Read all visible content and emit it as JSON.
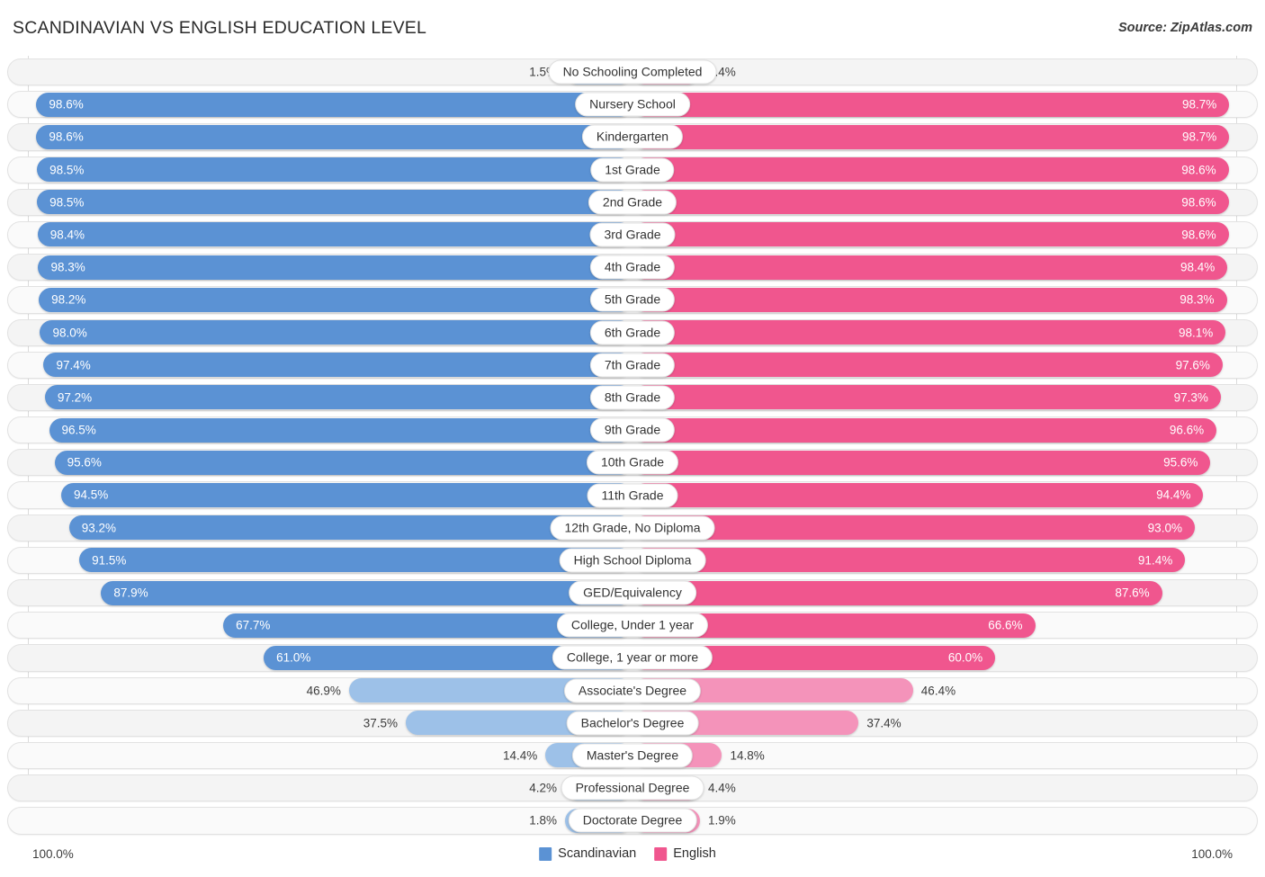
{
  "header": {
    "title": "SCANDINAVIAN VS ENGLISH EDUCATION LEVEL",
    "source": "Source: ZipAtlas.com"
  },
  "footer": {
    "axis_min": "100.0%",
    "axis_max": "100.0%",
    "legend": [
      {
        "label": "Scandinavian",
        "color": "#5b92d4"
      },
      {
        "label": "English",
        "color": "#f0568e"
      }
    ]
  },
  "colors": {
    "scandinavian_strong": "#5b92d4",
    "scandinavian_light": "#9dc1e8",
    "english_strong": "#f0568e",
    "english_light": "#f493ba",
    "track": "#f4f4f4",
    "label_text": "#333333"
  },
  "chart_data": {
    "type": "bar",
    "title": "SCANDINAVIAN VS ENGLISH EDUCATION LEVEL",
    "subtitle": "Source: ZipAtlas.com",
    "orientation": "horizontal-diverging",
    "xlabel": "",
    "ylabel": "",
    "xlim": [
      0,
      100
    ],
    "axis_min_label": "100.0%",
    "axis_max_label": "100.0%",
    "grid": false,
    "legend_position": "bottom-center",
    "categories": [
      "No Schooling Completed",
      "Nursery School",
      "Kindergarten",
      "1st Grade",
      "2nd Grade",
      "3rd Grade",
      "4th Grade",
      "5th Grade",
      "6th Grade",
      "7th Grade",
      "8th Grade",
      "9th Grade",
      "10th Grade",
      "11th Grade",
      "12th Grade, No Diploma",
      "High School Diploma",
      "GED/Equivalency",
      "College, Under 1 year",
      "College, 1 year or more",
      "Associate's Degree",
      "Bachelor's Degree",
      "Master's Degree",
      "Professional Degree",
      "Doctorate Degree"
    ],
    "series": [
      {
        "name": "Scandinavian",
        "color": "#5b92d4",
        "values": [
          1.5,
          98.6,
          98.6,
          98.5,
          98.5,
          98.4,
          98.3,
          98.2,
          98.0,
          97.4,
          97.2,
          96.5,
          95.6,
          94.5,
          93.2,
          91.5,
          87.9,
          67.7,
          61.0,
          46.9,
          37.5,
          14.4,
          4.2,
          1.8
        ]
      },
      {
        "name": "English",
        "color": "#f0568e",
        "values": [
          1.4,
          98.7,
          98.7,
          98.6,
          98.6,
          98.6,
          98.4,
          98.3,
          98.1,
          97.6,
          97.3,
          96.6,
          95.6,
          94.4,
          93.0,
          91.4,
          87.6,
          66.6,
          60.0,
          46.4,
          37.4,
          14.8,
          4.4,
          1.9
        ]
      }
    ]
  },
  "rows": [
    {
      "label": "No Schooling Completed",
      "left_value": 1.5,
      "left_text": "1.5%",
      "right_value": 1.4,
      "right_text": "1.4%"
    },
    {
      "label": "Nursery School",
      "left_value": 98.6,
      "left_text": "98.6%",
      "right_value": 98.7,
      "right_text": "98.7%"
    },
    {
      "label": "Kindergarten",
      "left_value": 98.6,
      "left_text": "98.6%",
      "right_value": 98.7,
      "right_text": "98.7%"
    },
    {
      "label": "1st Grade",
      "left_value": 98.5,
      "left_text": "98.5%",
      "right_value": 98.6,
      "right_text": "98.6%"
    },
    {
      "label": "2nd Grade",
      "left_value": 98.5,
      "left_text": "98.5%",
      "right_value": 98.6,
      "right_text": "98.6%"
    },
    {
      "label": "3rd Grade",
      "left_value": 98.4,
      "left_text": "98.4%",
      "right_value": 98.6,
      "right_text": "98.6%"
    },
    {
      "label": "4th Grade",
      "left_value": 98.3,
      "left_text": "98.3%",
      "right_value": 98.4,
      "right_text": "98.4%"
    },
    {
      "label": "5th Grade",
      "left_value": 98.2,
      "left_text": "98.2%",
      "right_value": 98.3,
      "right_text": "98.3%"
    },
    {
      "label": "6th Grade",
      "left_value": 98.0,
      "left_text": "98.0%",
      "right_value": 98.1,
      "right_text": "98.1%"
    },
    {
      "label": "7th Grade",
      "left_value": 97.4,
      "left_text": "97.4%",
      "right_value": 97.6,
      "right_text": "97.6%"
    },
    {
      "label": "8th Grade",
      "left_value": 97.2,
      "left_text": "97.2%",
      "right_value": 97.3,
      "right_text": "97.3%"
    },
    {
      "label": "9th Grade",
      "left_value": 96.5,
      "left_text": "96.5%",
      "right_value": 96.6,
      "right_text": "96.6%"
    },
    {
      "label": "10th Grade",
      "left_value": 95.6,
      "left_text": "95.6%",
      "right_value": 95.6,
      "right_text": "95.6%"
    },
    {
      "label": "11th Grade",
      "left_value": 94.5,
      "left_text": "94.5%",
      "right_value": 94.4,
      "right_text": "94.4%"
    },
    {
      "label": "12th Grade, No Diploma",
      "left_value": 93.2,
      "left_text": "93.2%",
      "right_value": 93.0,
      "right_text": "93.0%"
    },
    {
      "label": "High School Diploma",
      "left_value": 91.5,
      "left_text": "91.5%",
      "right_value": 91.4,
      "right_text": "91.4%"
    },
    {
      "label": "GED/Equivalency",
      "left_value": 87.9,
      "left_text": "87.9%",
      "right_value": 87.6,
      "right_text": "87.6%"
    },
    {
      "label": "College, Under 1 year",
      "left_value": 67.7,
      "left_text": "67.7%",
      "right_value": 66.6,
      "right_text": "66.6%"
    },
    {
      "label": "College, 1 year or more",
      "left_value": 61.0,
      "left_text": "61.0%",
      "right_value": 60.0,
      "right_text": "60.0%"
    },
    {
      "label": "Associate's Degree",
      "left_value": 46.9,
      "left_text": "46.9%",
      "right_value": 46.4,
      "right_text": "46.4%"
    },
    {
      "label": "Bachelor's Degree",
      "left_value": 37.5,
      "left_text": "37.5%",
      "right_value": 37.4,
      "right_text": "37.4%"
    },
    {
      "label": "Master's Degree",
      "left_value": 14.4,
      "left_text": "14.4%",
      "right_value": 14.8,
      "right_text": "14.8%"
    },
    {
      "label": "Professional Degree",
      "left_value": 4.2,
      "left_text": "4.2%",
      "right_value": 4.4,
      "right_text": "4.4%"
    },
    {
      "label": "Doctorate Degree",
      "left_value": 1.8,
      "left_text": "1.8%",
      "right_value": 1.9,
      "right_text": "1.9%"
    }
  ]
}
